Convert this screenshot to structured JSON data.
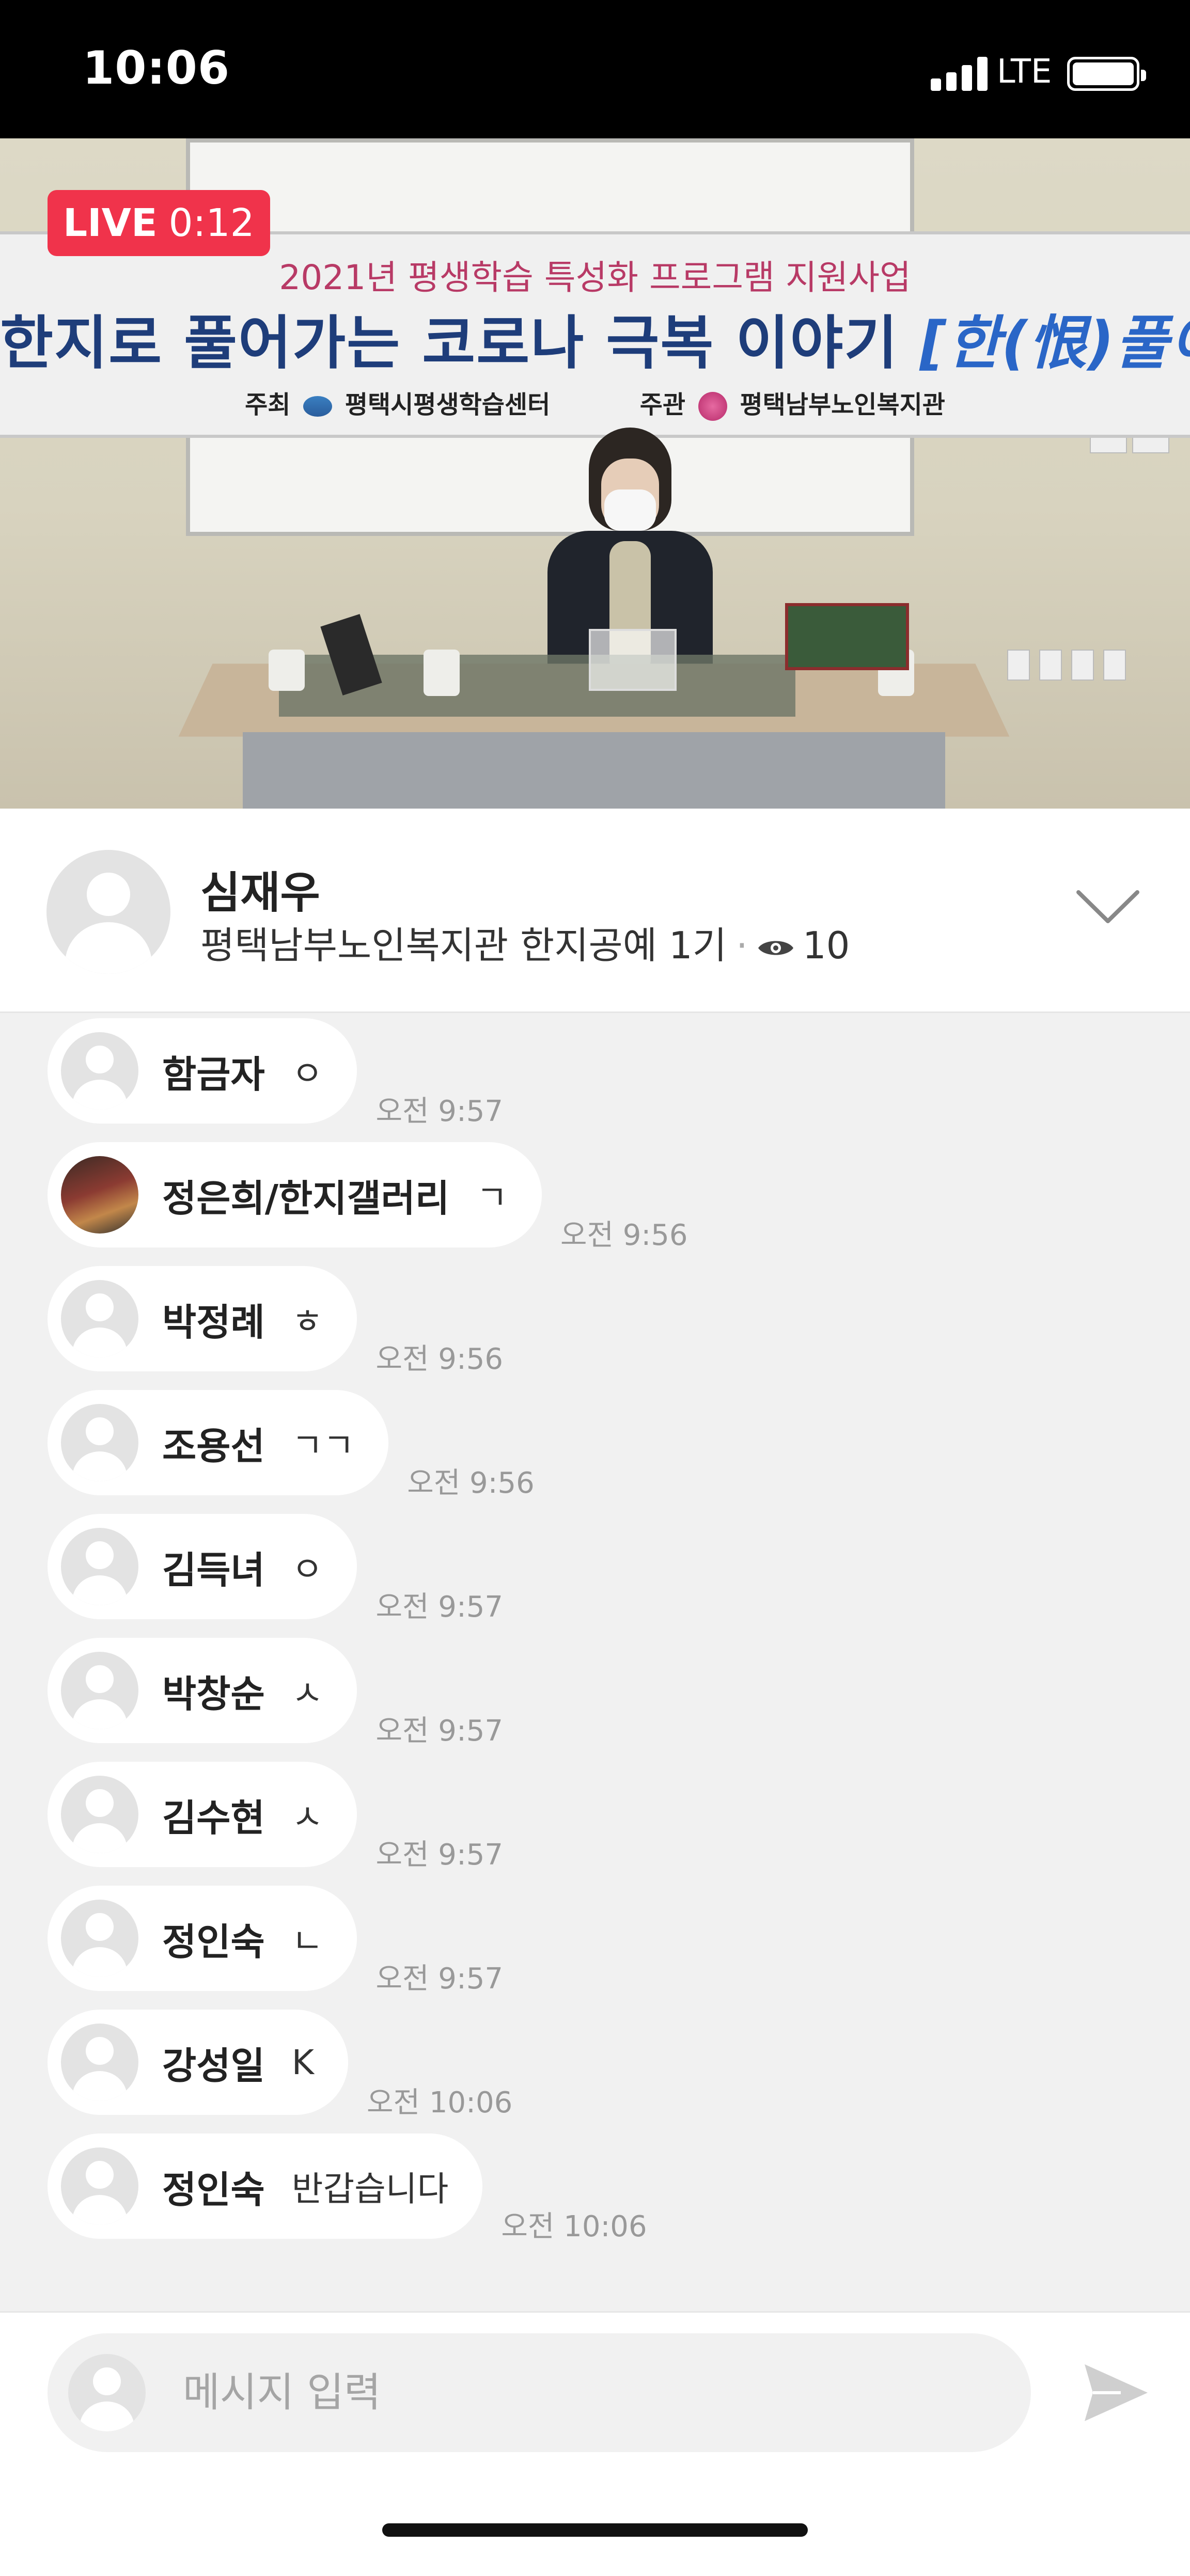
{
  "status_bar": {
    "time": "10:06",
    "network": "LTE"
  },
  "video": {
    "live_label": "LIVE",
    "elapsed": "0:12",
    "banner": {
      "subtitle": "2021년 평생학습 특성화 프로그램 지원사업",
      "title_main": "한지로 풀어가는 코로나 극복 이야기 ",
      "title_accent": "[한(恨)풀이]",
      "host_label": "주최",
      "host_org": "평택시평생학습센터",
      "organizer_label": "주관",
      "organizer_org": "평택남부노인복지관"
    }
  },
  "host": {
    "name": "심재우",
    "channel": "평택남부노인복지관 한지공예 1기",
    "viewer_count": "10"
  },
  "messages": [
    {
      "name": "함금자",
      "text": "ㅇ",
      "time": "오전 9:57",
      "avatar": "default"
    },
    {
      "name": "정은희/한지갤러리",
      "text": "ㄱ",
      "time": "오전 9:56",
      "avatar": "photo"
    },
    {
      "name": "박정례",
      "text": "ㅎ",
      "time": "오전 9:56",
      "avatar": "default"
    },
    {
      "name": "조용선",
      "text": "ㄱㄱ",
      "time": "오전 9:56",
      "avatar": "default"
    },
    {
      "name": "김득녀",
      "text": "ㅇ",
      "time": "오전 9:57",
      "avatar": "default"
    },
    {
      "name": "박창순",
      "text": "ㅅ",
      "time": "오전 9:57",
      "avatar": "default"
    },
    {
      "name": "김수현",
      "text": "ㅅ",
      "time": "오전 9:57",
      "avatar": "default"
    },
    {
      "name": "정인숙",
      "text": "ㄴ",
      "time": "오전 9:57",
      "avatar": "default"
    },
    {
      "name": "강성일",
      "text": "K",
      "time": "오전 10:06",
      "avatar": "default"
    },
    {
      "name": "정인숙",
      "text": "반갑습니다",
      "time": "오전 10:06",
      "avatar": "default"
    }
  ],
  "composer": {
    "placeholder": "메시지 입력",
    "value": ""
  },
  "colors": {
    "live_badge": "#f0334b",
    "chat_background": "#f1f1f1",
    "bubble": "#ffffff"
  }
}
